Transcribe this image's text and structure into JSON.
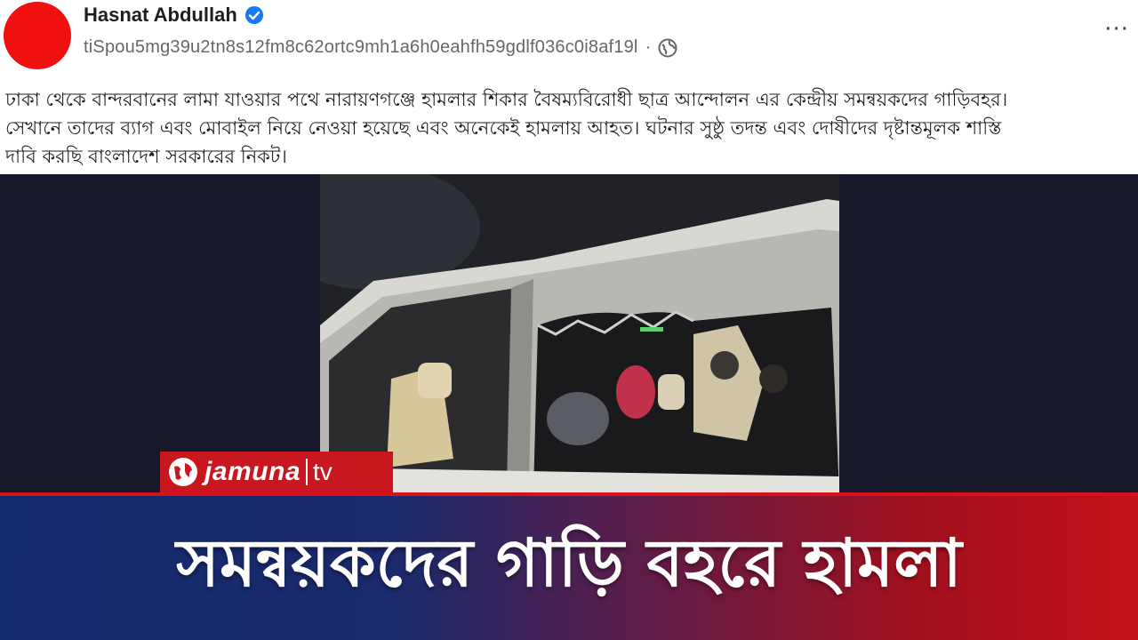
{
  "post": {
    "author": "Hasnat Abdullah",
    "meta_text": "tiSpou5mg39u2tn8s12fm8c62ortc9mh1a6h0eahfh59gdlf036c0i8af19l",
    "separator": "·",
    "more_label": "···",
    "body_lines": [
      "ঢাকা থেকে বান্দরবানের লামা যাওয়ার পথে নারায়ণগঞ্জে হামলার শিকার বৈষম্যবিরোধী ছাত্র আন্দোলন এর কেন্দ্রীয় সমন্বয়কদের গাড়িবহর।",
      "সেখানে তাদের ব্যাগ এবং মোবাইল নিয়ে নেওয়া হয়েছে এবং অনেকেই হামলায় আহত। ঘটনার সুষ্ঠু তদন্ত এবং দোষীদের দৃষ্টান্তমূলক শাস্তি",
      "দাবি করছি বাংলাদেশ সরকারের নিকট।"
    ],
    "icons": [
      "verified-badge-icon",
      "globe-icon",
      "more-options-icon"
    ],
    "avatar_color": "#f01010",
    "verified_color": "#1877f2"
  },
  "logo": {
    "name": "jamuna",
    "suffix": "tv",
    "color": "#c8171e"
  },
  "headline": {
    "text": "সমন্বয়কদের গাড়ি বহরে হামলা",
    "band_colors": [
      "#13296e",
      "#c4101a"
    ]
  }
}
